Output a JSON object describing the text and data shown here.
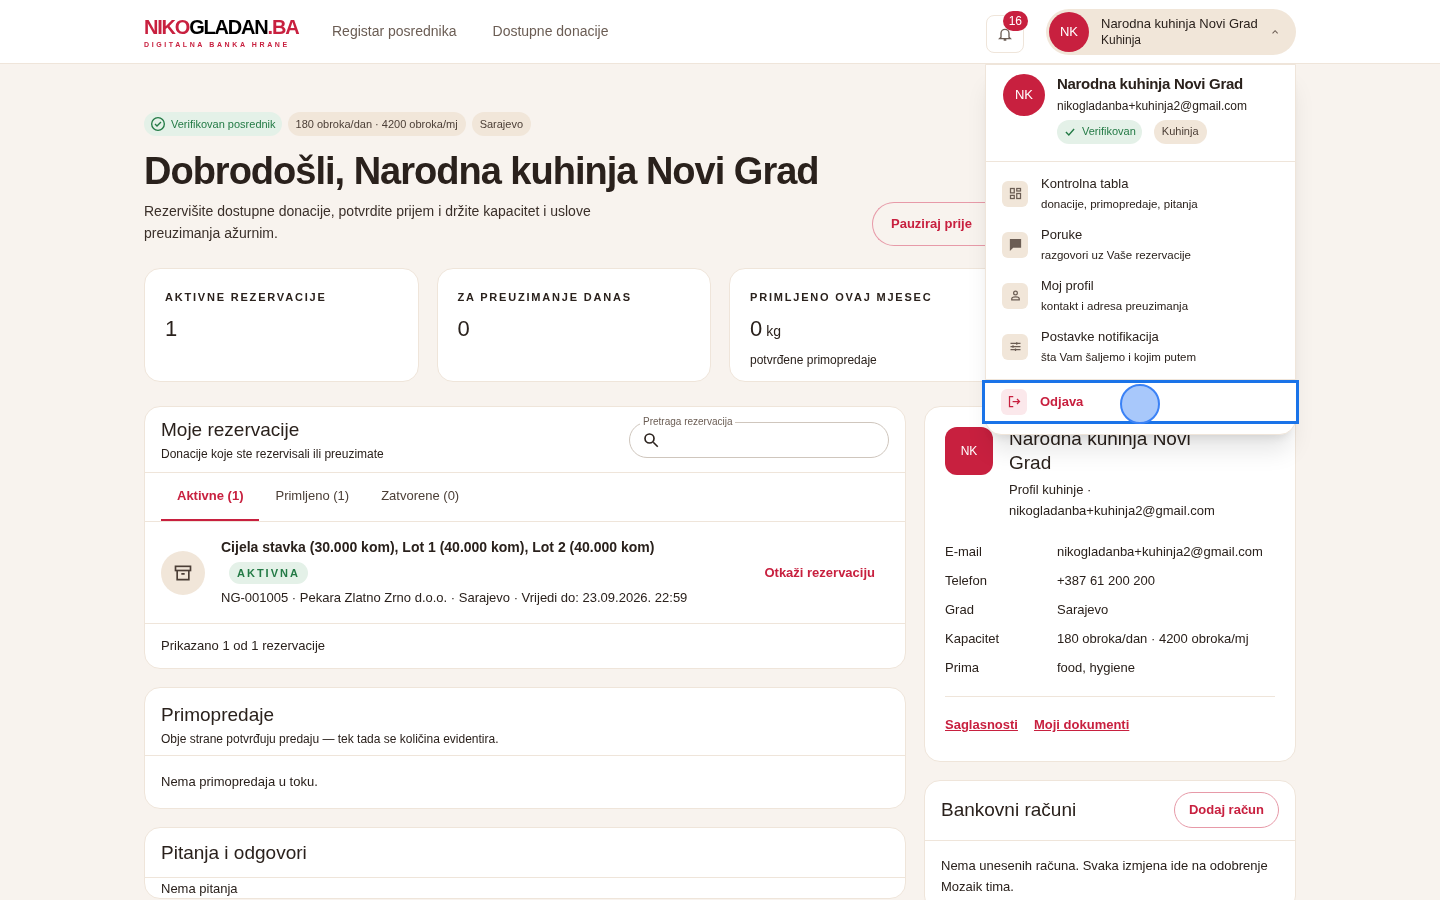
{
  "header": {
    "logo": {
      "first": "NIKO",
      "second": "GLADAN",
      "third": ".BA",
      "tagline": "DIGITALNA BANKA HRANE"
    },
    "nav": [
      "Registar posrednika",
      "Dostupne donacije"
    ],
    "notifications": {
      "count": "16"
    },
    "account": {
      "initials": "NK",
      "name": "Narodna kuhinja Novi Grad",
      "role": "Kuhinja",
      "expanded": true
    }
  },
  "account_menu": {
    "initials": "NK",
    "name": "Narodna kuhinja Novi Grad",
    "email": "nikogladanba+kuhinja2@gmail.com",
    "badges": [
      {
        "label": "Verifikovan",
        "kind": "verified"
      },
      {
        "label": "Kuhinja",
        "kind": "plain"
      }
    ],
    "items": [
      {
        "kind": "grid",
        "title": "Kontrolna tabla",
        "subtitle": "donacije, primopredaje, pitanja"
      },
      {
        "kind": "chat",
        "title": "Poruke",
        "subtitle": "razgovori uz Vaše rezervacije"
      },
      {
        "kind": "person",
        "title": "Moj profil",
        "subtitle": "kontakt i adresa preuzimanja"
      },
      {
        "kind": "sliders",
        "title": "Postavke notifikacija",
        "subtitle": "šta Vam šaljemo i kojim putem"
      }
    ],
    "logout": {
      "label": "Odjava",
      "highlighted": true
    }
  },
  "hero": {
    "badges": [
      {
        "label": "Verifikovan posrednik",
        "kind": "verified"
      },
      {
        "label": "180 obroka/dan · 4200 obroka/mj",
        "kind": "plain"
      },
      {
        "label": "Sarajevo",
        "kind": "plain"
      }
    ],
    "title": "Dobrodošli, Narodna kuhinja Novi Grad",
    "subtitle": "Rezervišite dostupne donacije, potvrdite prijem i držite kapacitet i uslove preuzimanja ažurnim.",
    "pause_button": "Pauziraj prije"
  },
  "stats": [
    {
      "label": "AKTIVNE REZERVACIJE",
      "value": "1"
    },
    {
      "label": "ZA PREUZIMANJE DANAS",
      "value": "0"
    },
    {
      "label": "PRIMLJENO OVAJ MJESEC",
      "value": "0",
      "unit": "kg",
      "note": "potvrđene primopredaje"
    }
  ],
  "reservations": {
    "title": "Moje rezervacije",
    "subtitle": "Donacije koje ste rezervisali ili preuzimate",
    "search": {
      "label": "Pretraga rezervacija"
    },
    "tabs": [
      {
        "label": "Aktivne (1)",
        "selected": true
      },
      {
        "label": "Primljeno (1)",
        "selected": false
      },
      {
        "label": "Zatvorene (0)",
        "selected": false
      }
    ],
    "items": [
      {
        "title": "Cijela stavka (30.000 kom), Lot 1 (40.000 kom), Lot 2 (40.000 kom)",
        "status": "AKTIVNA",
        "meta": "NG-001005 · Pekara Zlatno Zrno d.o.o. · Sarajevo · Vrijedi do: 23.09.2026. 22:59",
        "action": "Otkaži rezervaciju"
      }
    ],
    "footer": "Prikazano 1 od 1 rezervacije"
  },
  "handovers": {
    "title": "Primopredaje",
    "subtitle": "Obje strane potvrđuju predaju — tek tada se količina evidentira.",
    "empty": "Nema primopredaja u toku."
  },
  "questions": {
    "title": "Pitanja i odgovori",
    "empty": "Nema pitanja"
  },
  "profile": {
    "initials": "NK",
    "name": "Narodna kuhinja Novi Grad",
    "subtitle": "Profil kuhinje ·",
    "email": "nikogladanba+kuhinja2@gmail.com",
    "fields": [
      {
        "label": "E-mail",
        "value": "nikogladanba+kuhinja2@gmail.com"
      },
      {
        "label": "Telefon",
        "value": "+387 61 200 200"
      },
      {
        "label": "Grad",
        "value": "Sarajevo"
      },
      {
        "label": "Kapacitet",
        "value": "180 obroka/dan · 4200 obroka/mj"
      },
      {
        "label": "Prima",
        "value": "food, hygiene"
      }
    ],
    "links": [
      "Saglasnosti",
      "Moji dokumenti"
    ]
  },
  "bank": {
    "title": "Bankovni računi",
    "button": "Dodaj račun",
    "empty": "Nema unesenih računa. Svaka izmjena ide na odobrenje Mozaik tima."
  }
}
